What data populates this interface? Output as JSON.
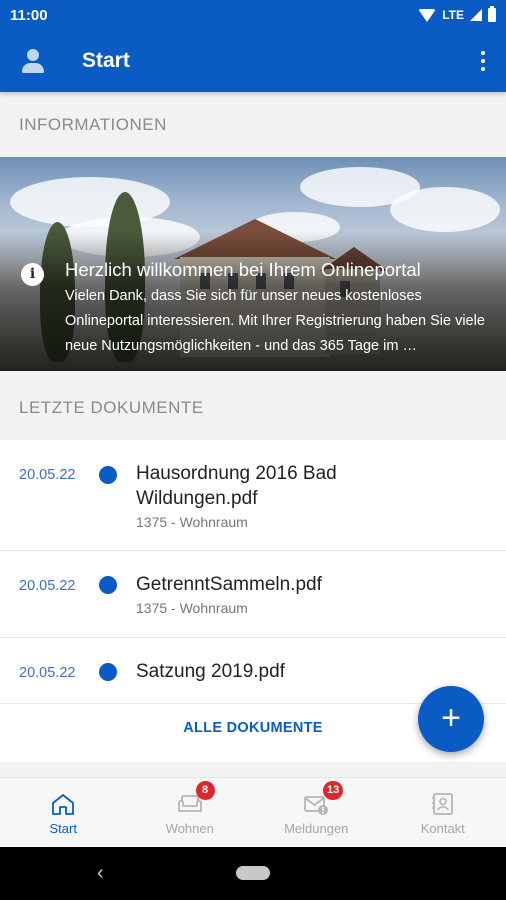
{
  "status_bar": {
    "time": "11:00",
    "network": "LTE"
  },
  "app_bar": {
    "title": "Start",
    "profile_icon": "person-icon",
    "menu_icon": "more-vert-icon"
  },
  "sections": {
    "info_header": "INFORMATIONEN",
    "docs_header": "LETZTE DOKUMENTE"
  },
  "info_card": {
    "title": "Herzlich willkommen bei Ihrem Onlineportal",
    "text": "Vielen Dank, dass Sie sich für unser neues kostenloses Onlineportal interessieren. Mit Ihrer Registrierung haben Sie viele neue Nutzungsmöglichkeiten - und das 365 Tage im …",
    "icon": "info-icon"
  },
  "documents": [
    {
      "date": "20.05.22",
      "title": "Hausordnung 2016 Bad Wildungen.pdf",
      "subtitle": "1375 - Wohnraum"
    },
    {
      "date": "20.05.22",
      "title": "GetrenntSammeln.pdf",
      "subtitle": "1375 - Wohnraum"
    },
    {
      "date": "20.05.22",
      "title": "Satzung 2019.pdf",
      "subtitle": ""
    }
  ],
  "all_documents_label": "ALLE DOKUMENTE",
  "fab": {
    "label": "+",
    "icon": "add-icon"
  },
  "bottom_nav": [
    {
      "label": "Start",
      "icon": "home-icon",
      "badge": "",
      "active": true
    },
    {
      "label": "Wohnen",
      "icon": "sofa-icon",
      "badge": "8",
      "active": false
    },
    {
      "label": "Meldungen",
      "icon": "mail-alert-icon",
      "badge": "13",
      "active": false
    },
    {
      "label": "Kontakt",
      "icon": "contact-book-icon",
      "badge": "",
      "active": false
    }
  ],
  "colors": {
    "primary": "#0b5bc4",
    "badge": "#e0262c",
    "date": "#3f6fb5"
  }
}
